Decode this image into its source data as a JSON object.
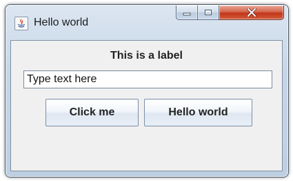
{
  "window": {
    "title": "Hello world",
    "icon": "java-icon",
    "controls": [
      "minimize-icon",
      "maximize-icon",
      "close-icon"
    ]
  },
  "content": {
    "label": "This is a label",
    "text_field_value": "Type text here",
    "buttons": {
      "click_label": "Click me",
      "hello_label": "Hello world"
    }
  },
  "colors": {
    "close_button": "#c7432a",
    "frame": "#c7d6e7",
    "client_background": "#f0f0f0"
  }
}
